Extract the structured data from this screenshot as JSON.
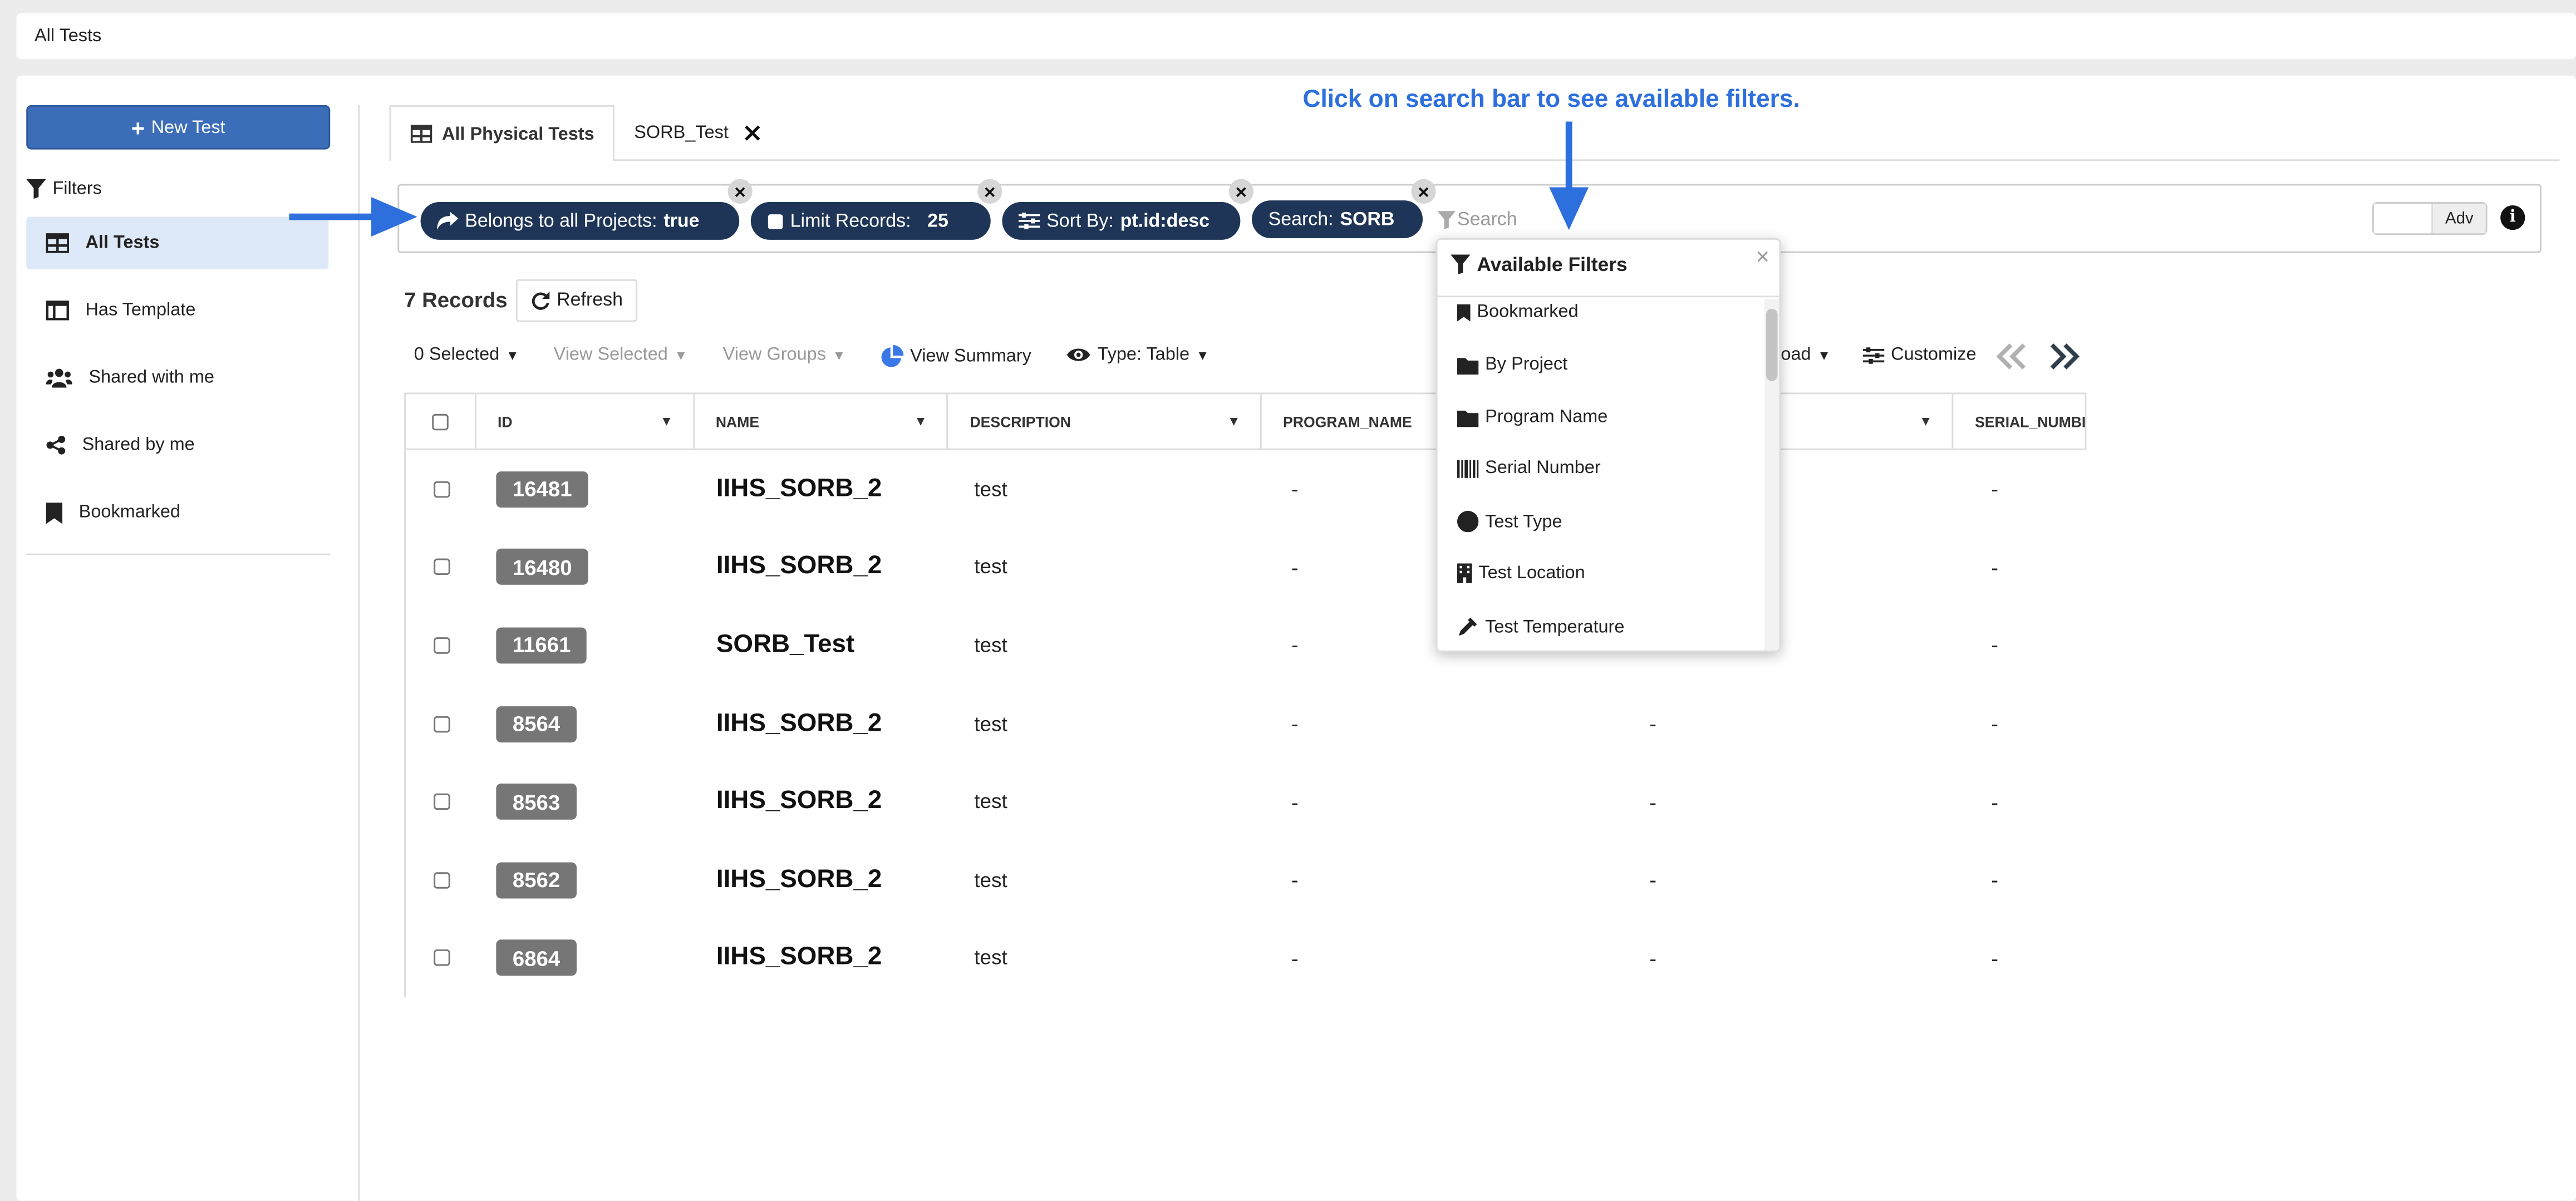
{
  "top_bar": {
    "title": "All Tests"
  },
  "sidebar": {
    "new_button": "New Test",
    "filters_label": "Filters",
    "items": [
      {
        "label": "All Tests",
        "icon": "table-icon",
        "active": true
      },
      {
        "label": "Has Template",
        "icon": "template-icon"
      },
      {
        "label": "Shared with me",
        "icon": "users-icon"
      },
      {
        "label": "Shared by me",
        "icon": "share-icon"
      },
      {
        "label": "Bookmarked",
        "icon": "bookmark-icon"
      }
    ]
  },
  "tabs": [
    {
      "label": "All Physical Tests",
      "active": true
    },
    {
      "label": "SORB_Test"
    }
  ],
  "instruction_text": "Click on search bar to see available filters.",
  "search": {
    "chips": [
      {
        "label": "Belongs to all Projects:",
        "value": "true"
      },
      {
        "label": "Limit Records:",
        "value": "25"
      },
      {
        "label": "Sort By:",
        "value": "pt.id:desc"
      },
      {
        "label": "Search:",
        "value": "SORB"
      }
    ],
    "placeholder": "Search",
    "adv_label": "Adv"
  },
  "records": {
    "count_text": "7 Records",
    "refresh_label": "Refresh"
  },
  "toolbar": {
    "selected": "0 Selected",
    "view_selected": "View Selected",
    "view_groups": "View Groups",
    "view_summary": "View Summary",
    "type": "Type: Table",
    "download": "oad",
    "customize": "Customize"
  },
  "table": {
    "columns": [
      "ID",
      "NAME",
      "DESCRIPTION",
      "PROGRAM_NAME",
      "",
      "SERIAL_NUMBE"
    ],
    "rows": [
      {
        "id": "16481",
        "name": "IIHS_SORB_2",
        "description": "test",
        "program_name": "-",
        "col5": "",
        "serial": "-"
      },
      {
        "id": "16480",
        "name": "IIHS_SORB_2",
        "description": "test",
        "program_name": "-",
        "col5": "",
        "serial": "-"
      },
      {
        "id": "11661",
        "name": "SORB_Test",
        "description": "test",
        "program_name": "-",
        "col5": "",
        "serial": "-"
      },
      {
        "id": "8564",
        "name": "IIHS_SORB_2",
        "description": "test",
        "program_name": "-",
        "col5": "-",
        "serial": "-"
      },
      {
        "id": "8563",
        "name": "IIHS_SORB_2",
        "description": "test",
        "program_name": "-",
        "col5": "-",
        "serial": "-"
      },
      {
        "id": "8562",
        "name": "IIHS_SORB_2",
        "description": "test",
        "program_name": "-",
        "col5": "-",
        "serial": "-"
      },
      {
        "id": "6864",
        "name": "IIHS_SORB_2",
        "description": "test",
        "program_name": "-",
        "col5": "-",
        "serial": "-"
      }
    ]
  },
  "available_filters": {
    "title": "Available Filters",
    "items": [
      {
        "label": "Bookmarked",
        "icon": "bookmark-icon"
      },
      {
        "label": "By Project",
        "icon": "folder-icon"
      },
      {
        "label": "Program Name",
        "icon": "folder-icon"
      },
      {
        "label": "Serial Number",
        "icon": "barcode-icon"
      },
      {
        "label": "Test Type",
        "icon": "circle-icon"
      },
      {
        "label": "Test Location",
        "icon": "building-icon"
      },
      {
        "label": "Test Temperature",
        "icon": "eyedropper-icon"
      }
    ]
  },
  "colors": {
    "primary": "#3b6db8",
    "chip": "#1f3557",
    "annotation": "#2d6fdc",
    "badge": "#767676",
    "active_item": "#dde9f8"
  }
}
